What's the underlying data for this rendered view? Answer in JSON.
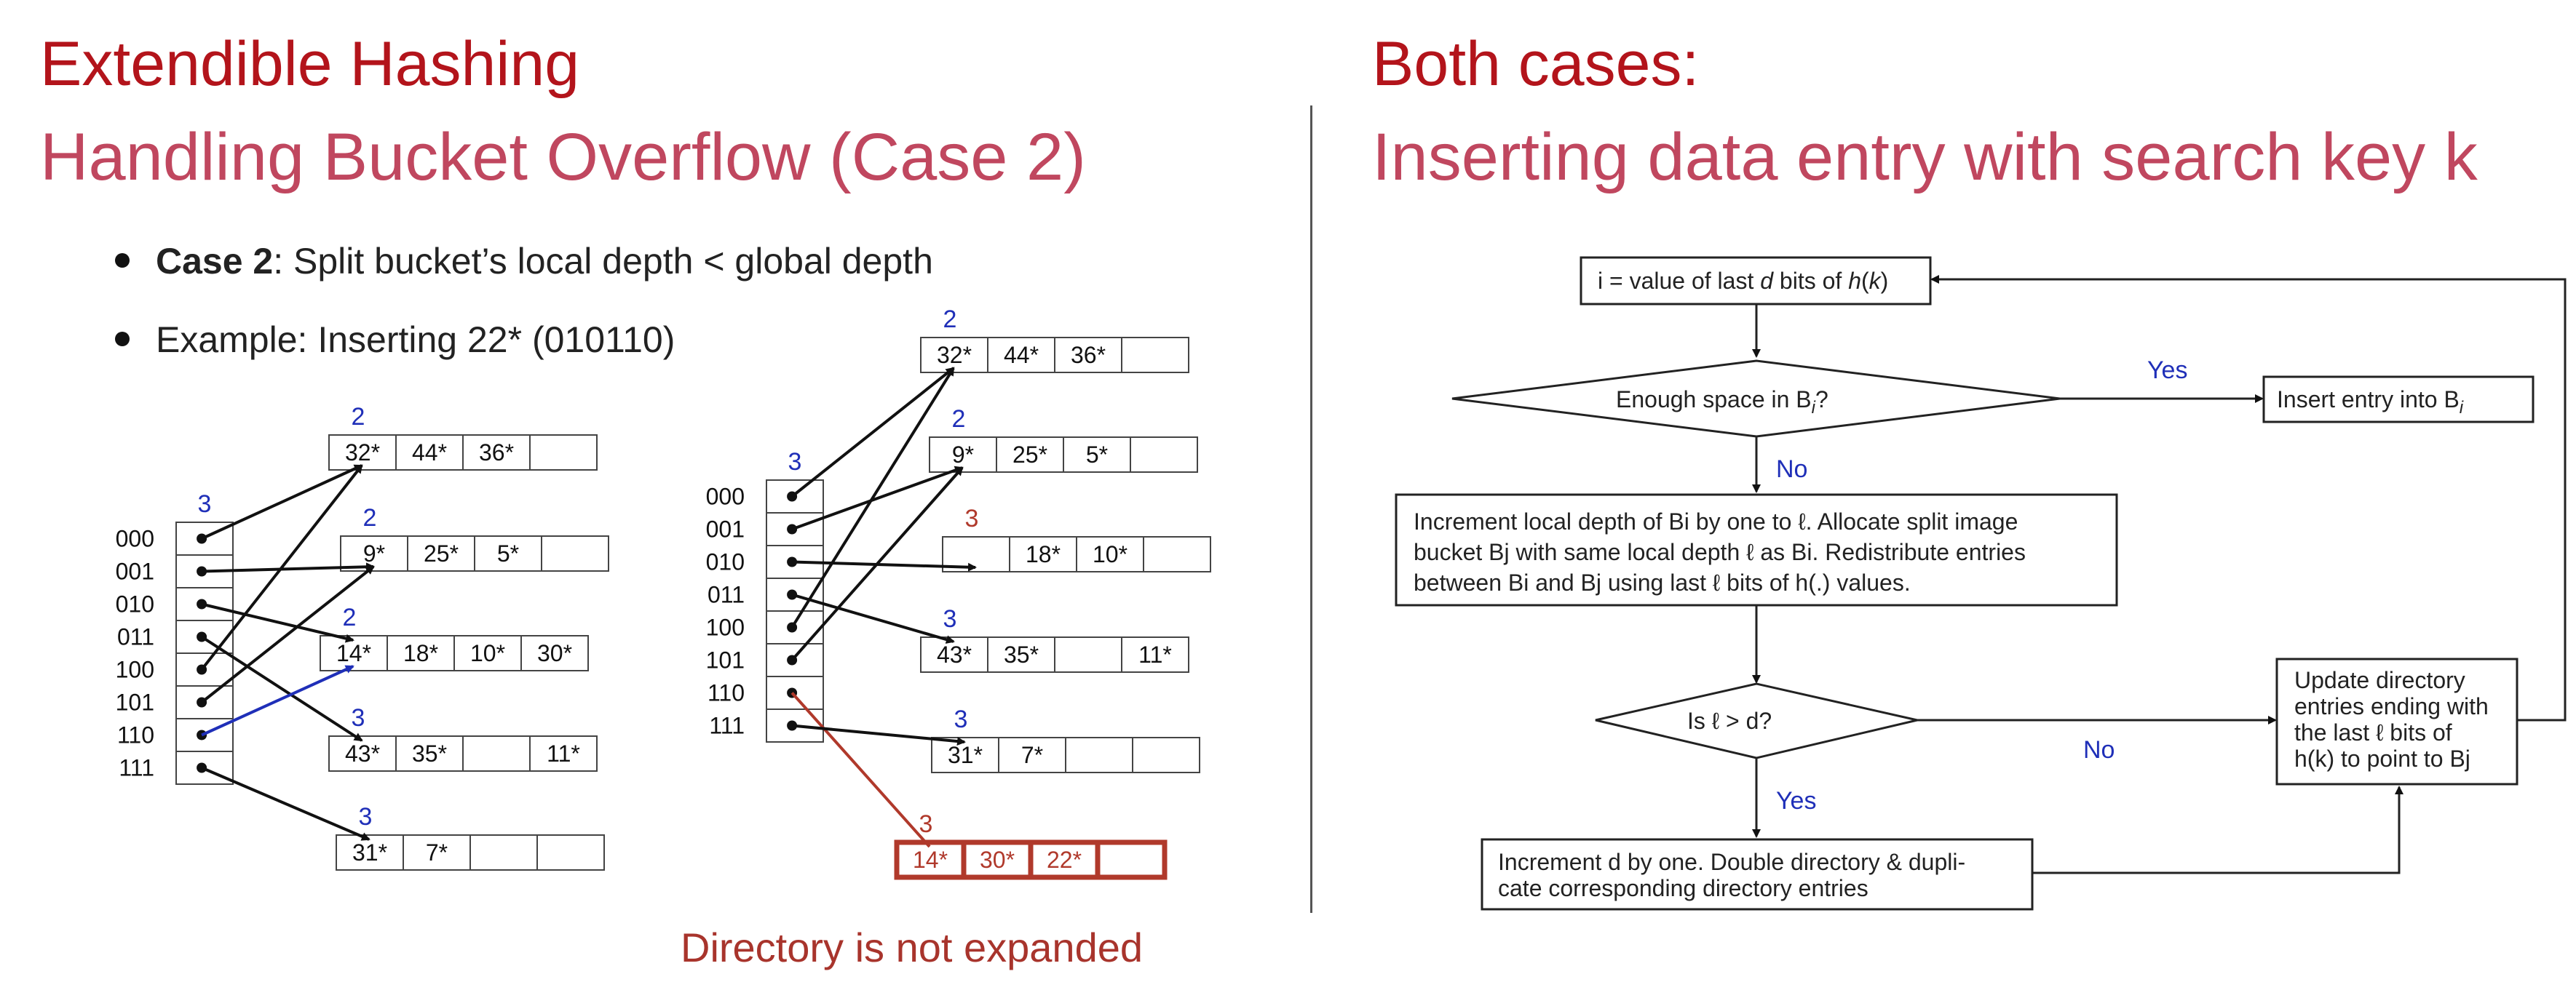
{
  "left": {
    "heading": "Extendible Hashing",
    "subheading": "Handling Bucket Overflow (Case 2)",
    "bullets": [
      {
        "bold": "Case 2",
        "text": ": Split bucket’s local depth < global depth"
      },
      {
        "bold": "",
        "text": "Example: Inserting 22* (010110)"
      }
    ],
    "note": "Directory is not expanded"
  },
  "right": {
    "heading": "Both cases:",
    "subheading": "Inserting data entry with search key k"
  },
  "before": {
    "global_depth": "3",
    "dir_labels": [
      "000",
      "001",
      "010",
      "011",
      "100",
      "101",
      "110",
      "111"
    ],
    "buckets": [
      {
        "depth": "2",
        "entries": [
          "32*",
          "44*",
          "36*",
          ""
        ]
      },
      {
        "depth": "2",
        "entries": [
          "9*",
          "25*",
          "5*",
          ""
        ]
      },
      {
        "depth": "2",
        "entries": [
          "14*",
          "18*",
          "10*",
          "30*"
        ]
      },
      {
        "depth": "3",
        "entries": [
          "43*",
          "35*",
          "",
          "11*"
        ]
      },
      {
        "depth": "3",
        "entries": [
          "31*",
          "7*",
          "",
          ""
        ]
      }
    ],
    "pointers": [
      0,
      1,
      2,
      3,
      0,
      1,
      2,
      4
    ]
  },
  "after": {
    "global_depth": "3",
    "dir_labels": [
      "000",
      "001",
      "010",
      "011",
      "100",
      "101",
      "110",
      "111"
    ],
    "buckets": [
      {
        "depth": "2",
        "entries": [
          "32*",
          "44*",
          "36*",
          ""
        ]
      },
      {
        "depth": "2",
        "entries": [
          "9*",
          "25*",
          "5*",
          ""
        ]
      },
      {
        "depth": "3",
        "entries": [
          "",
          "18*",
          "10*",
          ""
        ]
      },
      {
        "depth": "3",
        "entries": [
          "43*",
          "35*",
          "",
          "11*"
        ]
      },
      {
        "depth": "3",
        "entries": [
          "31*",
          "7*",
          "",
          ""
        ]
      },
      {
        "depth": "3",
        "entries": [
          "14*",
          "30*",
          "22*",
          ""
        ]
      }
    ],
    "pointers": [
      0,
      1,
      2,
      3,
      0,
      1,
      5,
      4
    ]
  },
  "flow": {
    "box_i": [
      "i = value of last ",
      "d",
      " bits of ",
      "h",
      "(",
      "k",
      ")"
    ],
    "enough_space": "Enough space in B",
    "enough_space_sub": "i",
    "yes1": "Yes",
    "insert": "Insert entry into B",
    "insert_sub": "i",
    "no1": "No",
    "increment_local": [
      "Increment local depth of Bi by one to ℓ.  Allocate split image",
      "bucket Bj with same local depth ℓ as Bi.  Redistribute entries",
      "between Bi and Bj using last ℓ bits of h(.) values."
    ],
    "is_l_gt_d": "Is ℓ > d?",
    "no2": "No",
    "yes2": "Yes",
    "update": [
      "Update    directory",
      "entries ending with",
      "the  last  ℓ  bits  of",
      "h(k) to point to Bj"
    ],
    "increment_d": [
      "Increment d by one.  Double directory & dupli-",
      "cate corresponding directory entries"
    ]
  },
  "colors": {
    "depth_blue": "#1f2fb8",
    "red_accent": "#b0392b",
    "flow_blue": "#1f2fb8"
  }
}
